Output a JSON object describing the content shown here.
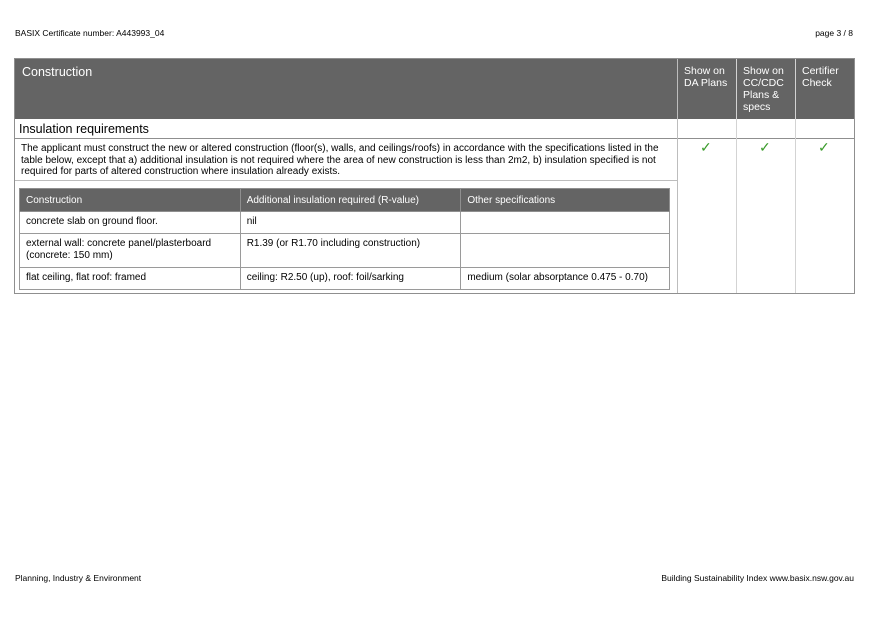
{
  "header": {
    "certificate": "BASIX Certificate number: A443993_04",
    "page": "page 3 / 8"
  },
  "footer": {
    "left": "Planning, Industry & Environment",
    "right": "Building Sustainability Index www.basix.nsw.gov.au"
  },
  "section": {
    "title": "Construction",
    "columns": [
      {
        "label": "Show on\nDA Plans"
      },
      {
        "label": "Show on\nCC/CDC\nPlans &\nspecs"
      },
      {
        "label": "Certifier\nCheck"
      }
    ]
  },
  "subsection": {
    "title": "Insulation requirements"
  },
  "requirement": {
    "text": "The applicant must construct the new or altered construction (floor(s), walls, and ceilings/roofs) in accordance with the specifications listed in the table below, except that a) additional insulation is not required where the area of new construction is less than 2m2, b) insulation specified is not required for parts of altered construction where insulation already exists.",
    "checks": [
      "✓",
      "✓",
      "✓"
    ]
  },
  "table": {
    "headers": [
      "Construction",
      "Additional insulation required (R-value)",
      "Other specifications"
    ],
    "rows": [
      [
        "concrete slab on ground floor.",
        "nil",
        ""
      ],
      [
        "external wall: concrete panel/plasterboard (concrete: 150 mm)",
        "R1.39 (or R1.70 including construction)",
        ""
      ],
      [
        "flat ceiling, flat roof: framed",
        "ceiling: R2.50 (up), roof: foil/sarking",
        "medium (solar absorptance 0.475 - 0.70)"
      ]
    ]
  },
  "colors": {
    "header_bg": "#646464",
    "check": "#3a9b2a"
  }
}
